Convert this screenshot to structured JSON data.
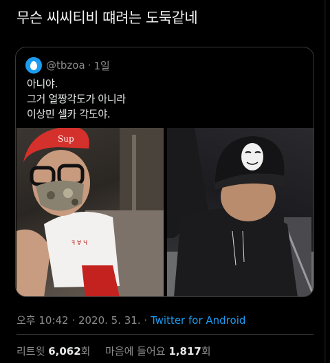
{
  "tweet": {
    "text": "무슨 씨씨티비 떄려는 도둑같네"
  },
  "quote": {
    "handle": "@tbzoa",
    "separator": "·",
    "time": "1일",
    "lines": [
      "아니야.",
      "그거 얼짱각도가 아니라",
      "이상민 셀카 각도야."
    ],
    "images": [
      "selfie-photo-left",
      "selfie-photo-right"
    ]
  },
  "metadata": {
    "time": "오후 10:42",
    "separator": "·",
    "date": "2020. 5. 31.",
    "source": "Twitter for Android"
  },
  "stats": {
    "retweet_label": "리트윗",
    "retweet_count": "6,062",
    "retweet_unit": "회",
    "like_label": "마음에 들어요",
    "like_count": "1,817",
    "like_unit": "회"
  },
  "colors": {
    "background": "#000000",
    "link": "#1d9bf0",
    "secondary_text": "#8b8b8b"
  }
}
